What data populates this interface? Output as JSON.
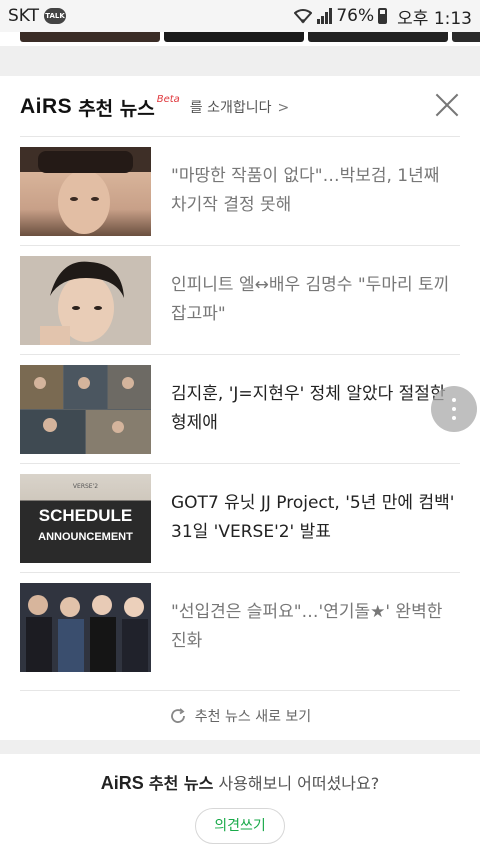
{
  "statusbar": {
    "carrier": "SKT",
    "talk_badge": "TALK",
    "battery": "76%",
    "time": "오후 1:13"
  },
  "card": {
    "brand": "AiRS",
    "brand_sub": "추천 뉴스",
    "beta": "Beta",
    "intro": "를 소개합니다",
    "intro_chevron": ">",
    "news": [
      {
        "title": "\"마땅한 작품이 없다\"…박보검, 1년째 차기작 결정 못해",
        "read": true
      },
      {
        "title": "인피니트 엘↔배우 김명수 \"두마리 토끼 잡고파\"",
        "read": true
      },
      {
        "title": "김지훈, 'J=지현우' 정체 알았다 절절한 형제애",
        "read": false
      },
      {
        "title": "GOT7 유닛 JJ Project, '5년 만에 컴백' 31일 'VERSE'2' 발표",
        "read": false
      },
      {
        "title": "\"선입견은 슬퍼요\"…'연기돌★' 완벽한 진화",
        "read": true
      }
    ],
    "thumb_texts": {
      "verse": "VERSE'2",
      "schedule": "SCHEDULE",
      "announcement": "ANNOUNCEMENT"
    },
    "refresh_label": "추천 뉴스 새로 보기"
  },
  "footer": {
    "brand": "AiRS",
    "brand_sub": "추천 뉴스",
    "question": "사용해보니 어떠셨나요?",
    "feedback_label": "의견쓰기"
  },
  "colors": {
    "beta": "#e0393e",
    "feedback": "#1aaa4a"
  }
}
